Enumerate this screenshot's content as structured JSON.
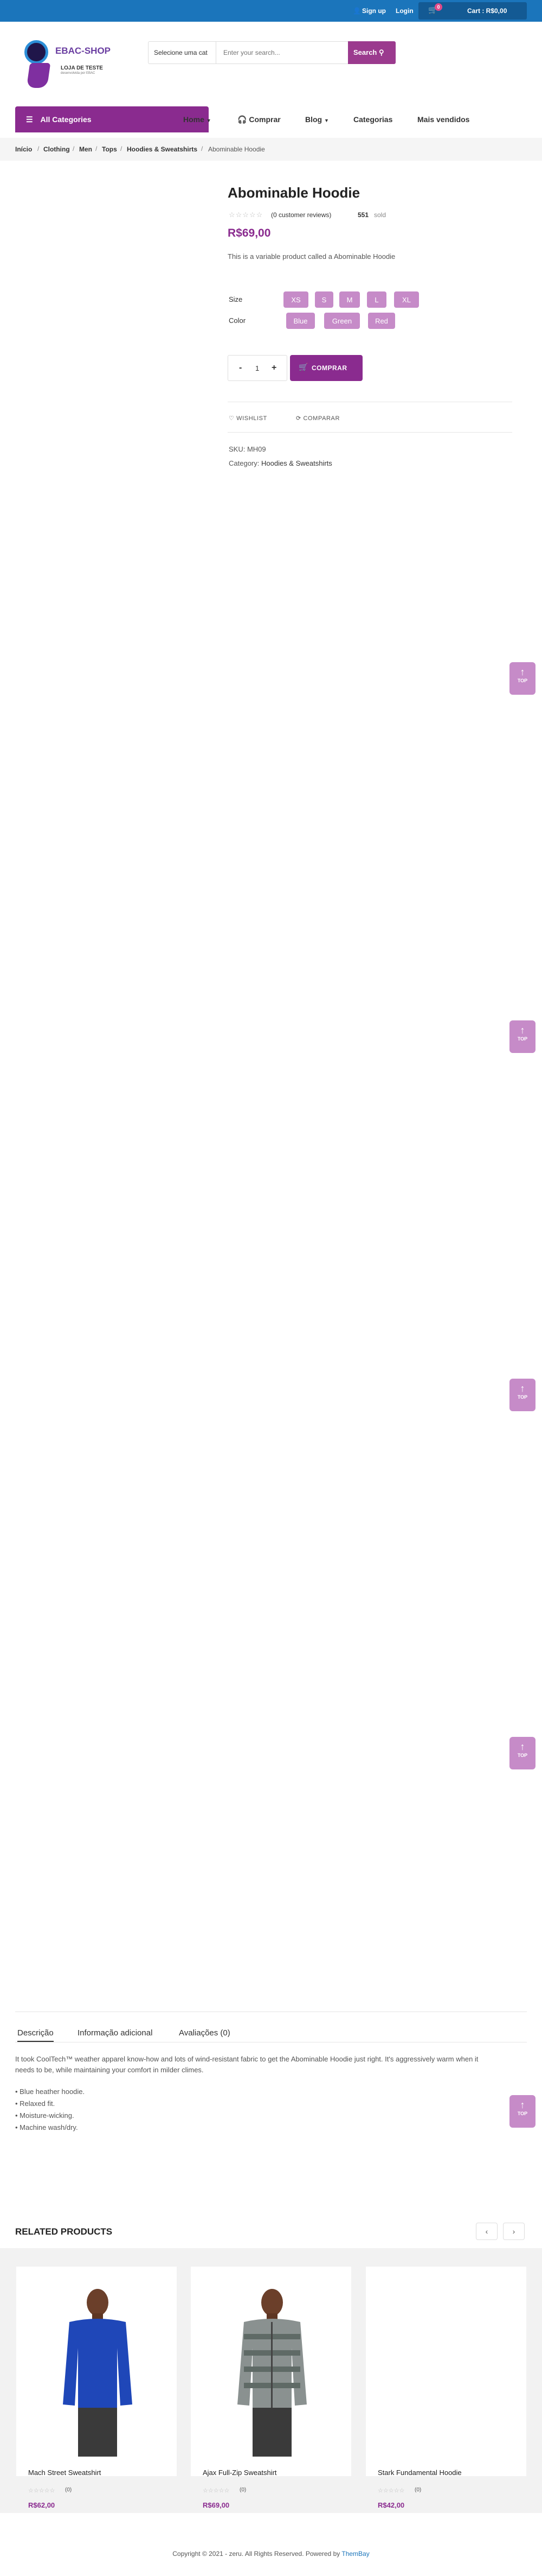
{
  "topbar": {
    "signup": "Sign up",
    "login": "Login",
    "cart_count": "0",
    "cart_label": "Cart : R$0,00"
  },
  "header": {
    "logo_title": "EBAC-SHOP",
    "logo_subtitle": "LOJA DE TESTE",
    "logo_tagline": "desenvolvida por EBAC",
    "search_select": "Selecione uma cat",
    "search_placeholder": "Enter your search...",
    "search_button": "Search"
  },
  "nav": {
    "all_categories": "All Categories",
    "items": [
      "Home",
      "Comprar",
      "Blog",
      "Categorias",
      "Mais vendidos"
    ]
  },
  "breadcrumb": [
    "Início",
    "Clothing",
    "Men",
    "Tops",
    "Hoodies & Sweatshirts",
    "Abominable Hoodie"
  ],
  "product": {
    "title": "Abominable Hoodie",
    "stars": "☆☆☆☆☆",
    "reviews": "(0 customer reviews)",
    "sold_count": "551",
    "sold_label": "sold",
    "price": "R$69,00",
    "description": "This is a variable product called a Abominable Hoodie",
    "size_label": "Size",
    "sizes": [
      "XS",
      "S",
      "M",
      "L",
      "XL"
    ],
    "color_label": "Color",
    "colors": [
      "Blue",
      "Green",
      "Red"
    ],
    "quantity": "1",
    "minus": "-",
    "plus": "+",
    "buy_button": "COMPRAR",
    "wishlist": "WISHLIST",
    "compare": "COMPARAR",
    "sku_label": "SKU:",
    "sku": "MH09",
    "category_label": "Category:",
    "category": "Hoodies & Sweatshirts"
  },
  "top_button": {
    "label": "TOP"
  },
  "tabs": {
    "items": [
      "Descrição",
      "Informação adicional",
      "Avaliações (0)"
    ],
    "description": "It took CoolTech™ weather apparel know-how and lots of wind-resistant fabric to get the Abominable Hoodie just right. It's aggressively warm when it",
    "description_2": "needs to be, while maintaining your comfort in milder climes.",
    "bullets": [
      "• Blue heather hoodie.",
      "• Relaxed fit.",
      "• Moisture-wicking.",
      "• Machine wash/dry."
    ]
  },
  "related": {
    "title": "RELATED PRODUCTS",
    "prev": "‹",
    "next": "›",
    "products": [
      {
        "name": "Mach Street Sweatshirt",
        "stars": "☆☆☆☆☆",
        "count": "(0)",
        "price": "R$62,00"
      },
      {
        "name": "Ajax Full-Zip Sweatshirt",
        "stars": "☆☆☆☆☆",
        "count": "(0)",
        "price": "R$69,00"
      },
      {
        "name": "Stark Fundamental Hoodie",
        "stars": "☆☆☆☆☆",
        "count": "(0)",
        "price": "R$42,00"
      }
    ]
  },
  "footer": {
    "copyright": "Copyright © 2021 - zeru. All Rights Reserved. Powered by",
    "brand": "ThemBay"
  },
  "colors": {
    "topbar": "#1b75bb",
    "accent": "#8a2b8f",
    "swatch": "#c68bc8"
  }
}
